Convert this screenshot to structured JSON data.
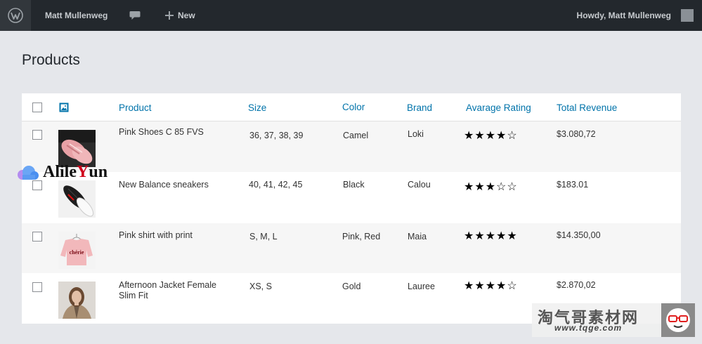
{
  "topbar": {
    "user_name": "Matt Mullenweg",
    "new_label": "New",
    "howdy": "Howdy,  Matt Mullenweg"
  },
  "page_title": "Products",
  "table": {
    "columns": [
      "Product",
      "Size",
      "Color",
      "Brand",
      "Avarage Rating",
      "Total Revenue"
    ],
    "rows": [
      {
        "product": "Pink Shoes C 85 FVS",
        "size": "36, 37, 38, 39",
        "color": "Camel",
        "brand": "Loki",
        "rating": 4,
        "stars": "★★★★☆",
        "revenue": "$3.080,72"
      },
      {
        "product": "New Balance sneakers",
        "size": "40, 41, 42, 45",
        "color": "Black",
        "brand": "Calou",
        "rating": 3,
        "stars": "★★★☆☆",
        "revenue": "$183.01"
      },
      {
        "product": "Pink shirt with print",
        "size": "S, M, L",
        "color": "Pink, Red",
        "brand": "Maia",
        "rating": 5,
        "stars": "★★★★★",
        "revenue": "$14.350,00"
      },
      {
        "product": "Afternoon Jacket Female Slim Fit",
        "size": "XS, S",
        "color": "Gold",
        "brand": "Lauree",
        "rating": 4,
        "stars": "★★★★☆",
        "revenue": "$2.870,02"
      }
    ]
  },
  "thumb_text": "chérie",
  "watermarks": {
    "alileyun_a": "Alile",
    "alileyun_y": "Y",
    "alileyun_b": "un",
    "tqge_cn": "淘气哥素材网",
    "tqge_url": "www.tqge.com"
  }
}
